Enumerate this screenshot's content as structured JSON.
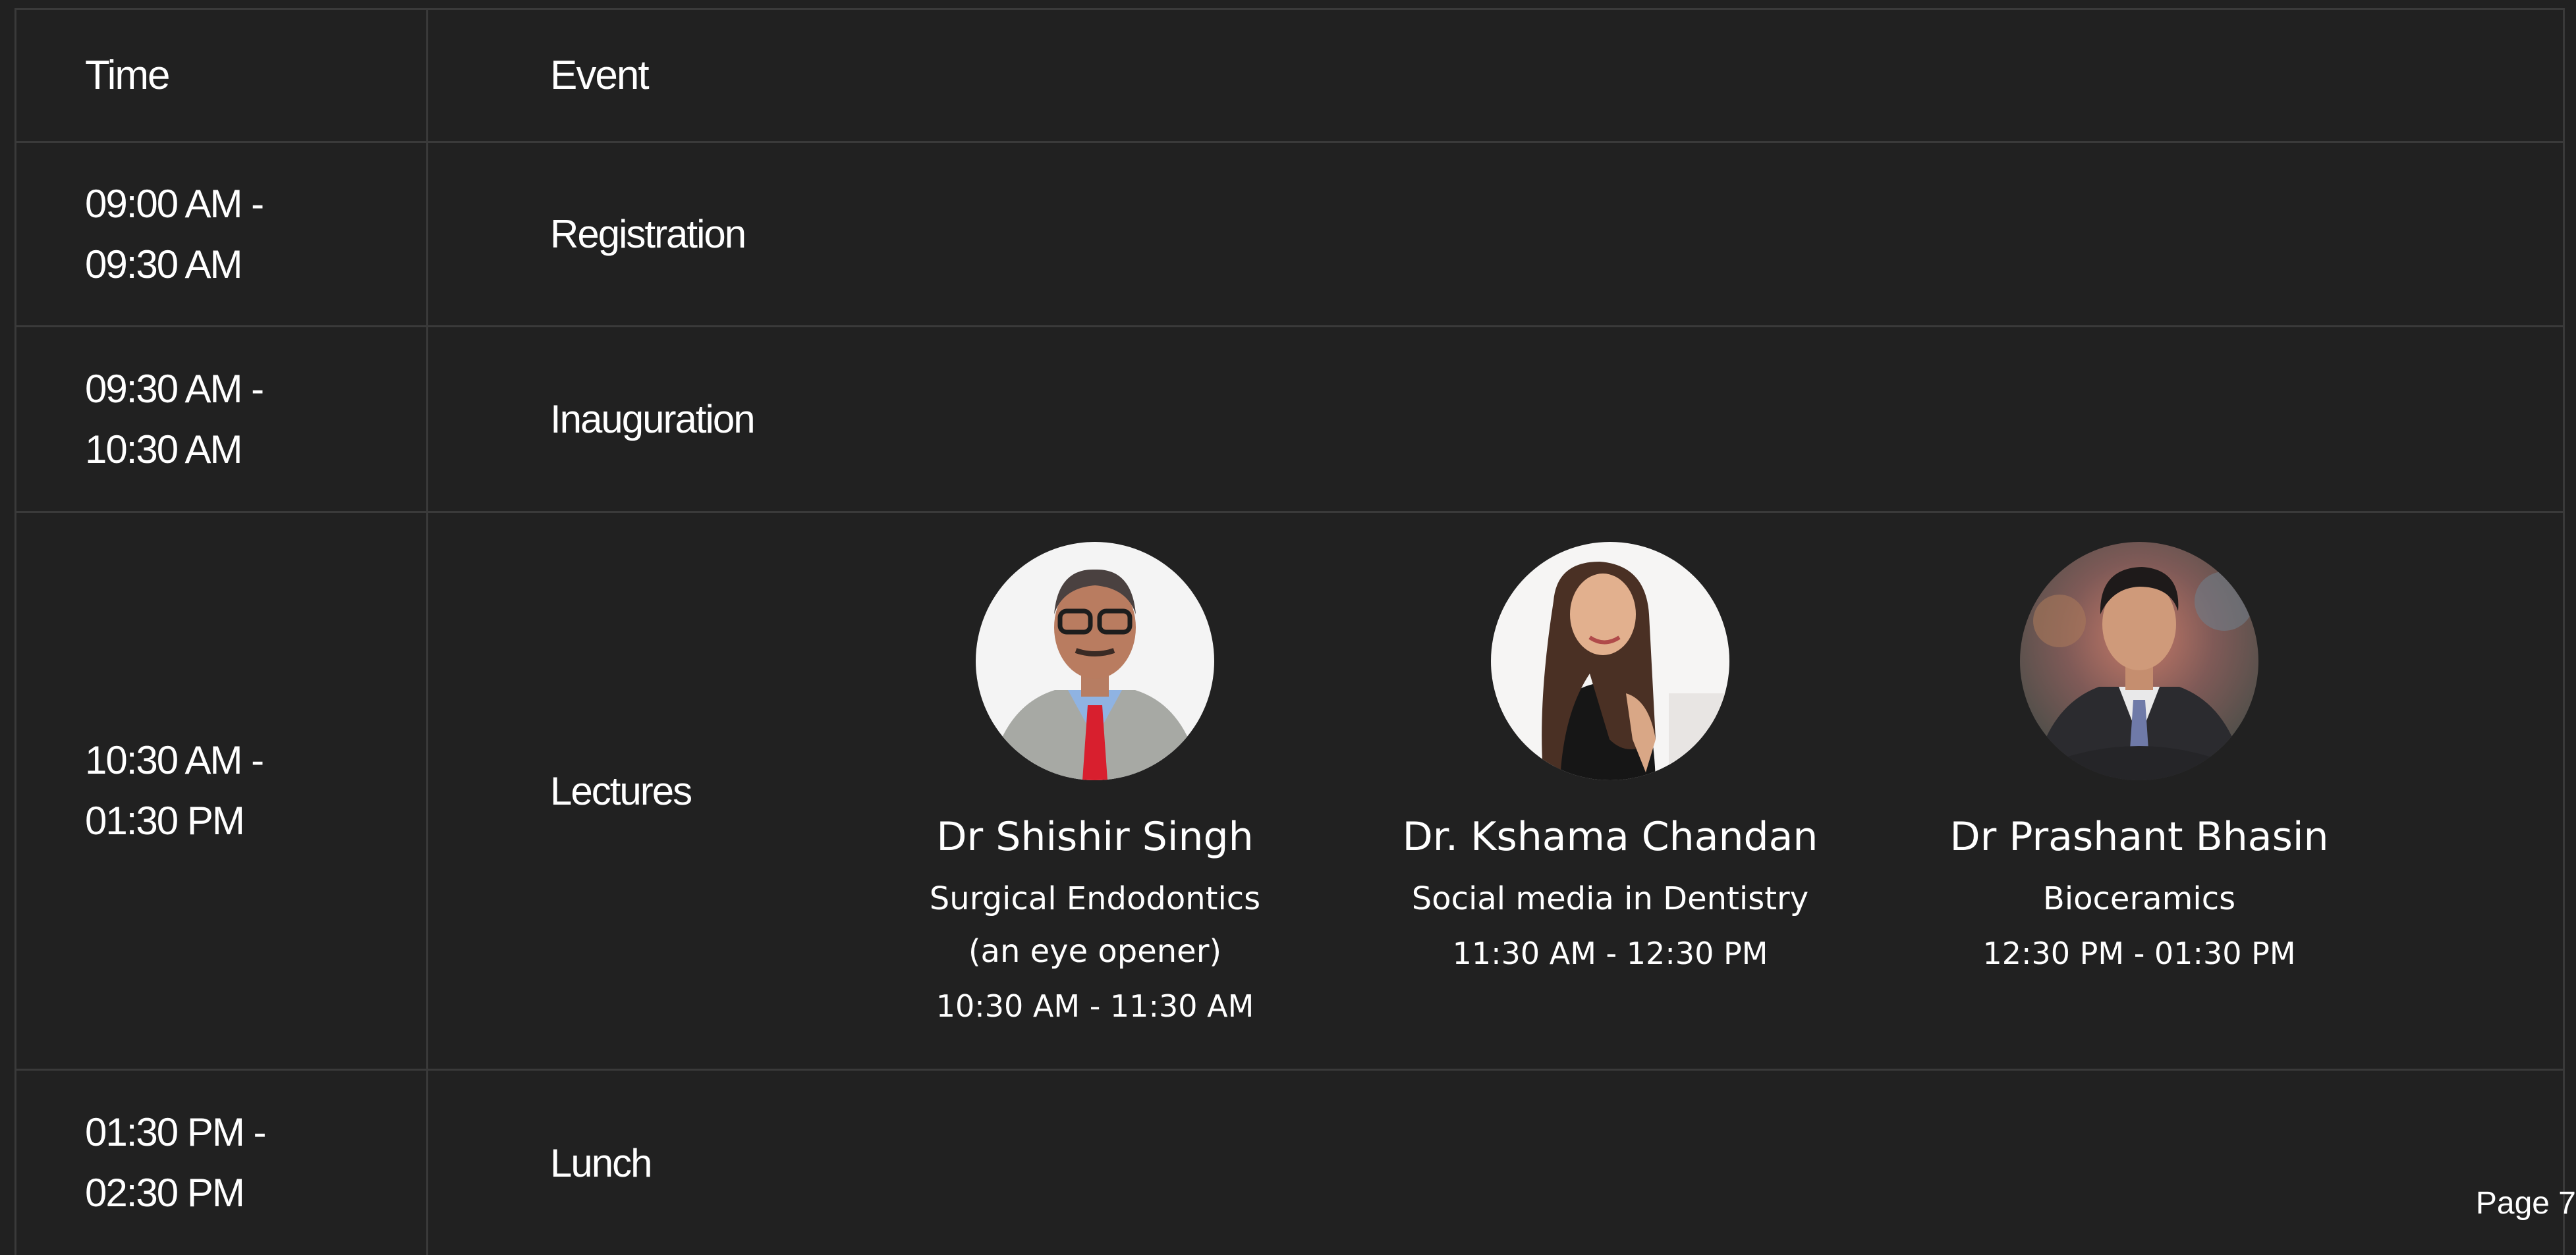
{
  "table": {
    "header": {
      "time": "Time",
      "event": "Event"
    },
    "rows": [
      {
        "time_line1": "09:00 AM -",
        "time_line2": "09:30 AM",
        "event": "Registration"
      },
      {
        "time_line1": "09:30 AM -",
        "time_line2": "10:30 AM",
        "event": "Inauguration"
      },
      {
        "time_line1": "10:30 AM -",
        "time_line2": "01:30 PM",
        "event": "Lectures"
      },
      {
        "time_line1": "01:30 PM -",
        "time_line2": "02:30 PM",
        "event": "Lunch"
      }
    ]
  },
  "speakers": [
    {
      "name": "Dr Shishir Singh",
      "topic_line1": "Surgical Endodontics",
      "topic_line2": "(an eye opener)",
      "time": "10:30 AM - 11:30 AM",
      "photo_icon": "speaker-photo-man-glasses"
    },
    {
      "name": "Dr. Kshama Chandan",
      "topic_line1": "Social media in Dentistry",
      "topic_line2": "",
      "time": "11:30 AM - 12:30 PM",
      "photo_icon": "speaker-photo-woman"
    },
    {
      "name": "Dr Prashant Bhasin",
      "topic_line1": "Bioceramics",
      "topic_line2": "",
      "time": "12:30 PM - 01:30 PM",
      "photo_icon": "speaker-photo-man-suit"
    }
  ],
  "page_label": "Page 7",
  "colors": {
    "background": "#212121",
    "grid": "#3a3a3a",
    "text": "#ffffff"
  }
}
